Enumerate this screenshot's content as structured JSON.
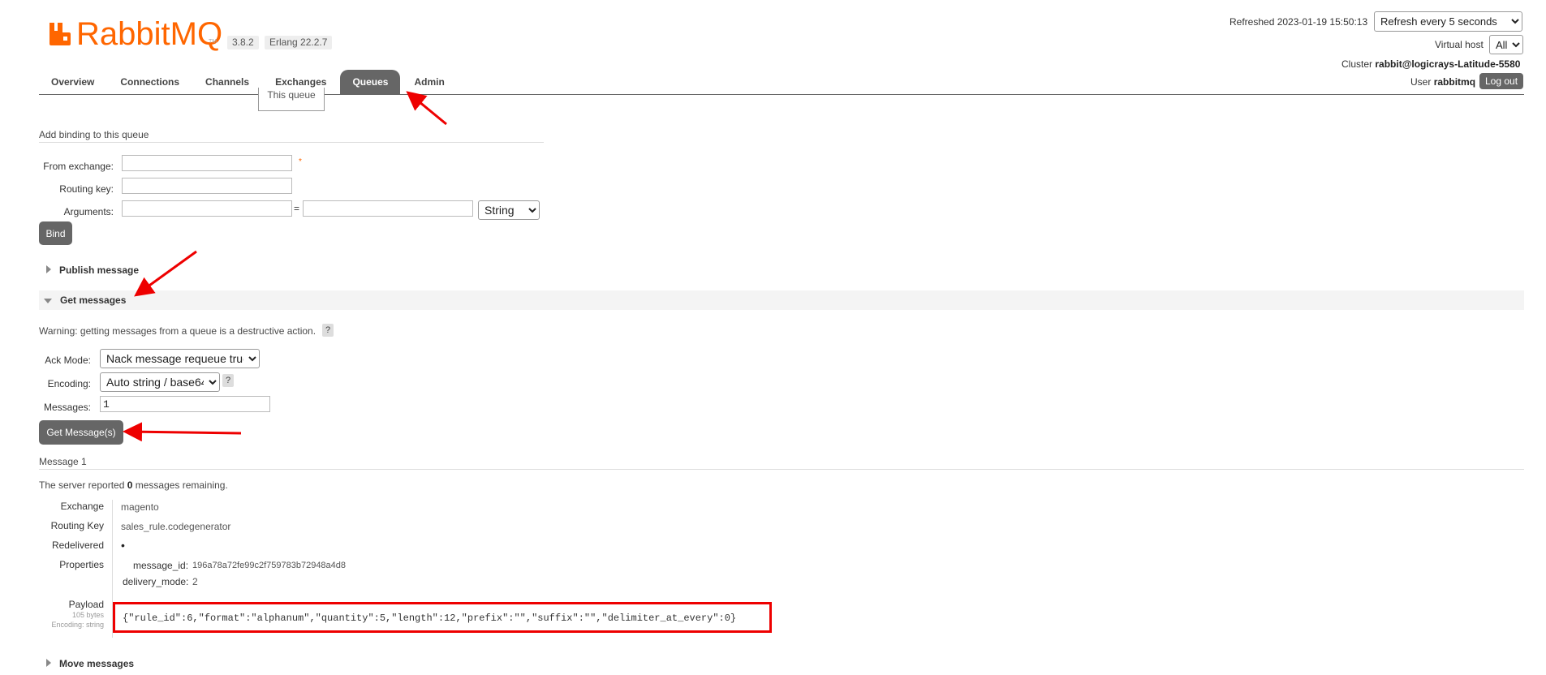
{
  "header": {
    "brand": "RabbitMQ",
    "tm": "TM",
    "version": "3.8.2",
    "erlang": "Erlang 22.2.7",
    "refreshed": "Refreshed 2023-01-19 15:50:13",
    "refresh_option": "Refresh every 5 seconds",
    "vhost_label": "Virtual host",
    "vhost_value": "All",
    "cluster_label": "Cluster",
    "cluster_value": "rabbit@logicrays-Latitude-5580",
    "user_label": "User",
    "user_value": "rabbitmq",
    "logout": "Log out"
  },
  "tabs": [
    "Overview",
    "Connections",
    "Channels",
    "Exchanges",
    "Queues",
    "Admin"
  ],
  "tooltip_text": "This queue",
  "binding": {
    "title": "Add binding to this queue",
    "from_exchange_label": "From exchange:",
    "routing_key_label": "Routing key:",
    "arguments_label": "Arguments:",
    "required_mark": "*",
    "equals": "=",
    "type_value": "String",
    "bind_button": "Bind"
  },
  "publish": {
    "title": "Publish message"
  },
  "get": {
    "title": "Get messages",
    "warning": "Warning: getting messages from a queue is a destructive action.",
    "help": "?",
    "ack_label": "Ack Mode:",
    "ack_value": "Nack message requeue true",
    "encoding_label": "Encoding:",
    "encoding_value": "Auto string / base64",
    "messages_label": "Messages:",
    "messages_value": "1",
    "button": "Get Message(s)"
  },
  "message": {
    "title": "Message 1",
    "server_pre": "The server reported ",
    "server_count": "0",
    "server_post": " messages remaining.",
    "exchange_label": "Exchange",
    "exchange_value": "magento",
    "routing_label": "Routing Key",
    "routing_value": "sales_rule.codegenerator",
    "redelivered_label": "Redelivered",
    "redelivered_value": "•",
    "properties_label": "Properties",
    "message_id_label": "message_id:",
    "message_id_value": "196a78a72fe99c2f759783b72948a4d8",
    "delivery_mode_label": "delivery_mode:",
    "delivery_mode_value": "2",
    "payload_label": "Payload",
    "payload_bytes": "105 bytes",
    "payload_encoding": "Encoding: string",
    "payload_value": "{\"rule_id\":6,\"format\":\"alphanum\",\"quantity\":5,\"length\":12,\"prefix\":\"\",\"suffix\":\"\",\"delimiter_at_every\":0}"
  },
  "move": {
    "title": "Move messages"
  },
  "colors": {
    "brand": "#ff6600",
    "tab_active": "#666666",
    "annotation": "#ee0000"
  }
}
